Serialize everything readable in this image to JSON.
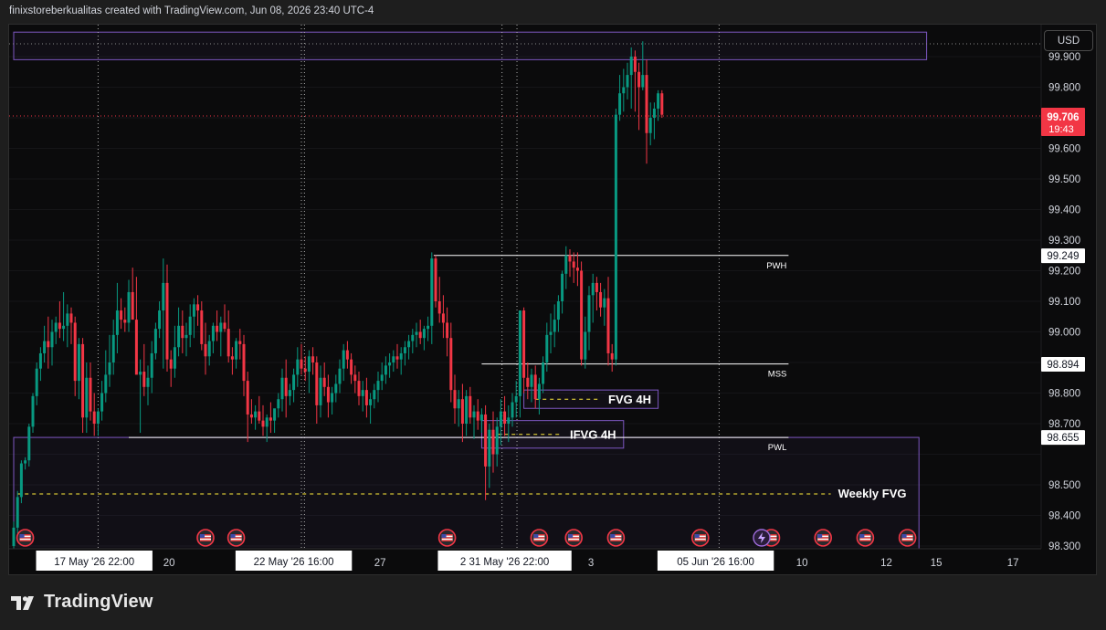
{
  "header": {
    "attribution": "finixstoreberkualitas created with TradingView.com, Jun 08, 2026 23:40 UTC-4"
  },
  "currency": "USD",
  "brand": "TradingView",
  "colors": {
    "up": "#089981",
    "down": "#f23645",
    "zone": "#7e57c2",
    "level": "#ffffff",
    "fvg_mid": "#ffeb3b",
    "price_tag": "#f23645"
  },
  "chart_data": {
    "type": "candlestick",
    "ylim": [
      98.28,
      99.98
    ],
    "y_ticks": [
      "99.900",
      "99.800",
      "99.600",
      "99.500",
      "99.400",
      "99.300",
      "99.200",
      "99.100",
      "99.000",
      "98.800",
      "98.700",
      "98.500",
      "98.400",
      "98.300"
    ],
    "x_ticks": [
      {
        "label": "20",
        "index": 40.5
      },
      {
        "label": "27",
        "index": 95.5
      },
      {
        "label": "3",
        "index": 150.5
      },
      {
        "label": "10",
        "index": 205.5
      },
      {
        "label": "12",
        "index": 227.5
      },
      {
        "label": "15",
        "index": 240.5
      },
      {
        "label": "17",
        "index": 260.5
      }
    ],
    "x_highlight_labels": [
      {
        "label": "17 May '26   22:00",
        "index": 21
      },
      {
        "label": "22 May '26   16:00",
        "index": 73
      },
      {
        "label": "2  31 May '26   22:00",
        "index": 128
      },
      {
        "label": "05 Jun '26   16:00",
        "index": 183
      }
    ],
    "session_markers": [
      22,
      75,
      75.8,
      127.3,
      131.2,
      183.9
    ],
    "current_price": {
      "value": "99.706",
      "timer": "19:43",
      "level": 99.706
    },
    "price_labels": [
      {
        "value": "99.249",
        "level": 99.249
      },
      {
        "value": "98.894",
        "level": 98.894
      },
      {
        "value": "98.655",
        "level": 98.655
      }
    ],
    "levels": [
      {
        "label": "PWH",
        "price": 99.25,
        "x_start": 109.5,
        "x_end": 202
      },
      {
        "label": "MSS",
        "price": 98.895,
        "x_start": 122,
        "x_end": 202
      },
      {
        "label": "PWL",
        "price": 98.655,
        "x_start": 30,
        "x_end": 202
      },
      {
        "label": "Weekly FVG",
        "price": 98.47,
        "x_start": 1,
        "x_end": 213,
        "dashed": true
      }
    ],
    "zones": [
      {
        "label": "",
        "from": 0,
        "to": 238,
        "top": 99.98,
        "bottom": 99.89,
        "open": "top"
      },
      {
        "label": "Weekly FVG zone",
        "from": 0,
        "to": 236,
        "top": 98.655,
        "bottom": 98.28
      },
      {
        "label": "FVG 4H",
        "from": 133,
        "to": 168,
        "top": 98.81,
        "bottom": 98.75,
        "text_x": 155
      },
      {
        "label": "IFVG 4H",
        "from": 122,
        "to": 159,
        "top": 98.71,
        "bottom": 98.62,
        "text_x": 145
      }
    ],
    "fvg_midlines": [
      {
        "from": 136,
        "to": 153,
        "price": 98.78
      },
      {
        "from": 126,
        "to": 143,
        "price": 98.665
      }
    ],
    "event_flags": [
      3,
      50,
      58,
      113,
      137,
      146,
      157,
      179,
      197.5,
      211,
      222,
      233
    ],
    "lightning_index": 195,
    "candles": [
      [
        98.3,
        98.38,
        98.28,
        98.36
      ],
      [
        98.36,
        98.48,
        98.34,
        98.46
      ],
      [
        98.46,
        98.58,
        98.44,
        98.57
      ],
      [
        98.57,
        98.59,
        98.55,
        98.58
      ],
      [
        98.58,
        98.7,
        98.56,
        98.69
      ],
      [
        98.69,
        98.8,
        98.67,
        98.79
      ],
      [
        98.79,
        98.9,
        98.76,
        98.88
      ],
      [
        98.88,
        98.95,
        98.84,
        98.93
      ],
      [
        98.93,
        99.02,
        98.9,
        98.97
      ],
      [
        98.97,
        99.05,
        98.88,
        98.95
      ],
      [
        98.95,
        99.04,
        98.89,
        99.0
      ],
      [
        99.0,
        99.05,
        98.96,
        99.03
      ],
      [
        99.03,
        99.1,
        98.98,
        99.01
      ],
      [
        99.01,
        99.13,
        98.97,
        99.02
      ],
      [
        99.02,
        99.09,
        98.95,
        99.06
      ],
      [
        99.06,
        99.08,
        98.96,
        99.03
      ],
      [
        99.03,
        99.05,
        98.79,
        98.84
      ],
      [
        98.84,
        98.98,
        98.78,
        98.96
      ],
      [
        98.96,
        98.98,
        98.67,
        98.72
      ],
      [
        98.72,
        98.9,
        98.67,
        98.85
      ],
      [
        98.85,
        98.9,
        98.71,
        98.74
      ],
      [
        98.74,
        98.8,
        98.66,
        98.7
      ],
      [
        98.7,
        98.75,
        98.66,
        98.74
      ],
      [
        98.74,
        98.84,
        98.71,
        98.8
      ],
      [
        98.8,
        98.94,
        98.77,
        98.86
      ],
      [
        98.86,
        98.99,
        98.82,
        98.9
      ],
      [
        98.9,
        99.04,
        98.86,
        98.99
      ],
      [
        98.99,
        99.16,
        98.93,
        99.07
      ],
      [
        99.07,
        99.11,
        99.01,
        99.04
      ],
      [
        99.04,
        99.08,
        99.0,
        99.03
      ],
      [
        99.03,
        99.17,
        99.0,
        99.13
      ],
      [
        99.13,
        99.21,
        99.05,
        99.04
      ],
      [
        99.04,
        99.18,
        98.98,
        98.86
      ],
      [
        98.86,
        98.91,
        98.67,
        98.87
      ],
      [
        98.87,
        98.96,
        98.79,
        98.82
      ],
      [
        98.82,
        98.89,
        98.76,
        98.85
      ],
      [
        98.85,
        98.97,
        98.8,
        98.93
      ],
      [
        98.93,
        99.03,
        98.91,
        99.01
      ],
      [
        99.01,
        99.1,
        98.98,
        99.07
      ],
      [
        99.07,
        99.24,
        98.88,
        99.16
      ],
      [
        99.16,
        99.22,
        98.87,
        98.91
      ],
      [
        98.91,
        98.94,
        98.82,
        98.88
      ],
      [
        98.88,
        99.02,
        98.85,
        98.95
      ],
      [
        98.95,
        99.08,
        98.92,
        99.02
      ],
      [
        99.02,
        99.07,
        98.93,
        98.98
      ],
      [
        98.98,
        99.03,
        98.92,
        98.99
      ],
      [
        98.99,
        99.09,
        98.95,
        99.05
      ],
      [
        99.05,
        99.11,
        98.98,
        99.09
      ],
      [
        99.09,
        99.12,
        99.02,
        99.07
      ],
      [
        99.07,
        99.1,
        98.94,
        98.96
      ],
      [
        98.96,
        99.03,
        98.86,
        98.92
      ],
      [
        98.92,
        98.99,
        98.89,
        98.97
      ],
      [
        98.97,
        99.03,
        98.93,
        99.02
      ],
      [
        99.02,
        99.07,
        98.97,
        99.0
      ],
      [
        99.0,
        99.05,
        98.92,
        99.03
      ],
      [
        99.03,
        99.09,
        99.0,
        99.01
      ],
      [
        99.01,
        99.07,
        98.9,
        98.92
      ],
      [
        98.92,
        98.95,
        98.86,
        98.91
      ],
      [
        98.91,
        98.98,
        98.88,
        98.97
      ],
      [
        98.97,
        99.01,
        98.91,
        98.96
      ],
      [
        98.96,
        98.99,
        98.79,
        98.84
      ],
      [
        98.84,
        98.87,
        98.64,
        98.73
      ],
      [
        98.73,
        98.78,
        98.7,
        98.72
      ],
      [
        98.72,
        98.76,
        98.68,
        98.74
      ],
      [
        98.74,
        98.79,
        98.7,
        98.71
      ],
      [
        98.71,
        98.76,
        98.66,
        98.69
      ],
      [
        98.69,
        98.73,
        98.64,
        98.72
      ],
      [
        98.72,
        98.77,
        98.67,
        98.71
      ],
      [
        98.71,
        98.74,
        98.67,
        98.75
      ],
      [
        98.75,
        98.8,
        98.72,
        98.78
      ],
      [
        98.78,
        98.88,
        98.74,
        98.85
      ],
      [
        98.85,
        98.91,
        98.72,
        98.79
      ],
      [
        98.79,
        98.83,
        98.76,
        98.81
      ],
      [
        98.81,
        98.88,
        98.77,
        98.86
      ],
      [
        98.86,
        98.95,
        98.82,
        98.91
      ],
      [
        98.91,
        98.96,
        98.86,
        98.88
      ],
      [
        98.88,
        98.92,
        98.84,
        98.87
      ],
      [
        98.87,
        98.94,
        98.8,
        98.92
      ],
      [
        98.92,
        98.95,
        98.86,
        98.9
      ],
      [
        98.9,
        98.92,
        98.7,
        98.76
      ],
      [
        98.76,
        98.89,
        98.72,
        98.85
      ],
      [
        98.85,
        98.9,
        98.79,
        98.82
      ],
      [
        98.82,
        98.86,
        98.72,
        98.77
      ],
      [
        98.77,
        98.82,
        98.73,
        98.8
      ],
      [
        98.8,
        98.86,
        98.77,
        98.83
      ],
      [
        98.83,
        98.91,
        98.8,
        98.88
      ],
      [
        98.88,
        98.96,
        98.84,
        98.94
      ],
      [
        98.94,
        98.97,
        98.88,
        98.91
      ],
      [
        98.91,
        98.93,
        98.83,
        98.86
      ],
      [
        98.86,
        98.89,
        98.8,
        98.84
      ],
      [
        98.84,
        98.87,
        98.76,
        98.79
      ],
      [
        98.79,
        98.84,
        98.74,
        98.81
      ],
      [
        98.81,
        98.85,
        98.72,
        98.76
      ],
      [
        98.76,
        98.8,
        98.7,
        98.78
      ],
      [
        98.78,
        98.83,
        98.75,
        98.81
      ],
      [
        98.81,
        98.87,
        98.77,
        98.84
      ],
      [
        98.84,
        98.9,
        98.81,
        98.86
      ],
      [
        98.86,
        98.92,
        98.83,
        98.89
      ],
      [
        98.89,
        98.93,
        98.85,
        98.9
      ],
      [
        98.9,
        98.94,
        98.87,
        98.92
      ],
      [
        98.92,
        98.96,
        98.88,
        98.91
      ],
      [
        98.91,
        98.95,
        98.86,
        98.93
      ],
      [
        98.93,
        98.97,
        98.89,
        98.95
      ],
      [
        98.95,
        98.99,
        98.91,
        98.97
      ],
      [
        98.97,
        99.01,
        98.93,
        98.99
      ],
      [
        98.99,
        99.03,
        98.95,
        99.0
      ],
      [
        99.0,
        99.04,
        98.96,
        98.98
      ],
      [
        98.98,
        99.02,
        98.94,
        99.01
      ],
      [
        99.01,
        99.05,
        98.97,
        99.02
      ],
      [
        99.02,
        99.26,
        98.96,
        99.24
      ],
      [
        99.24,
        99.25,
        99.08,
        99.1
      ],
      [
        99.1,
        99.18,
        99.03,
        99.06
      ],
      [
        99.06,
        99.12,
        98.98,
        99.03
      ],
      [
        99.03,
        99.08,
        98.92,
        98.98
      ],
      [
        98.98,
        99.03,
        98.77,
        98.81
      ],
      [
        98.81,
        98.86,
        98.7,
        98.75
      ],
      [
        98.75,
        98.81,
        98.69,
        98.78
      ],
      [
        98.78,
        98.83,
        98.64,
        98.7
      ],
      [
        98.7,
        98.81,
        98.66,
        98.79
      ],
      [
        98.79,
        98.82,
        98.7,
        98.72
      ],
      [
        98.72,
        98.76,
        98.65,
        98.74
      ],
      [
        98.74,
        98.78,
        98.68,
        98.71
      ],
      [
        98.71,
        98.75,
        98.67,
        98.73
      ],
      [
        98.73,
        98.76,
        98.45,
        98.56
      ],
      [
        98.56,
        98.7,
        98.49,
        98.68
      ],
      [
        98.68,
        98.74,
        98.54,
        98.6
      ],
      [
        98.6,
        98.72,
        98.56,
        98.69
      ],
      [
        98.69,
        98.78,
        98.63,
        98.74
      ],
      [
        98.74,
        98.79,
        98.66,
        98.7
      ],
      [
        98.7,
        98.76,
        98.64,
        98.72
      ],
      [
        98.72,
        98.8,
        98.69,
        98.77
      ],
      [
        98.77,
        98.84,
        98.72,
        98.79
      ],
      [
        98.79,
        99.07,
        98.72,
        99.07
      ],
      [
        99.07,
        99.08,
        98.8,
        98.85
      ],
      [
        98.85,
        98.9,
        98.78,
        98.82
      ],
      [
        98.82,
        98.88,
        98.77,
        98.86
      ],
      [
        98.86,
        98.89,
        98.75,
        98.78
      ],
      [
        98.78,
        98.85,
        98.73,
        98.83
      ],
      [
        98.83,
        98.92,
        98.8,
        98.9
      ],
      [
        98.9,
        99.03,
        98.87,
        98.99
      ],
      [
        98.99,
        99.06,
        98.93,
        99.0
      ],
      [
        99.0,
        99.09,
        98.95,
        99.04
      ],
      [
        99.04,
        99.12,
        99.0,
        99.1
      ],
      [
        99.1,
        99.2,
        99.06,
        99.19
      ],
      [
        99.19,
        99.28,
        99.14,
        99.25
      ],
      [
        99.25,
        99.27,
        99.18,
        99.23
      ],
      [
        99.23,
        99.26,
        99.16,
        99.21
      ],
      [
        99.21,
        99.26,
        99.15,
        99.2
      ],
      [
        99.2,
        99.23,
        98.89,
        98.91
      ],
      [
        98.91,
        99.05,
        98.88,
        99.0
      ],
      [
        99.0,
        99.15,
        98.94,
        99.12
      ],
      [
        99.12,
        99.19,
        99.03,
        99.16
      ],
      [
        99.16,
        99.18,
        99.07,
        99.13
      ],
      [
        99.13,
        99.16,
        99.05,
        99.08
      ],
      [
        99.08,
        99.14,
        99.02,
        99.11
      ],
      [
        99.11,
        99.18,
        98.89,
        98.93
      ],
      [
        98.93,
        98.96,
        98.87,
        98.91
      ],
      [
        98.91,
        99.73,
        98.89,
        99.71
      ],
      [
        99.71,
        99.84,
        99.69,
        99.78
      ],
      [
        99.78,
        99.86,
        99.72,
        99.8
      ],
      [
        99.8,
        99.88,
        99.76,
        99.84
      ],
      [
        99.84,
        99.93,
        99.73,
        99.9
      ],
      [
        99.9,
        99.92,
        99.72,
        99.85
      ],
      [
        99.85,
        99.88,
        99.66,
        99.8
      ],
      [
        99.8,
        99.95,
        99.79,
        99.84
      ],
      [
        99.84,
        99.89,
        99.55,
        99.65
      ],
      [
        99.65,
        99.75,
        99.61,
        99.7
      ],
      [
        99.7,
        99.75,
        99.63,
        99.73
      ],
      [
        99.73,
        99.79,
        99.69,
        99.78
      ],
      [
        99.78,
        99.79,
        99.7,
        99.71
      ]
    ]
  }
}
